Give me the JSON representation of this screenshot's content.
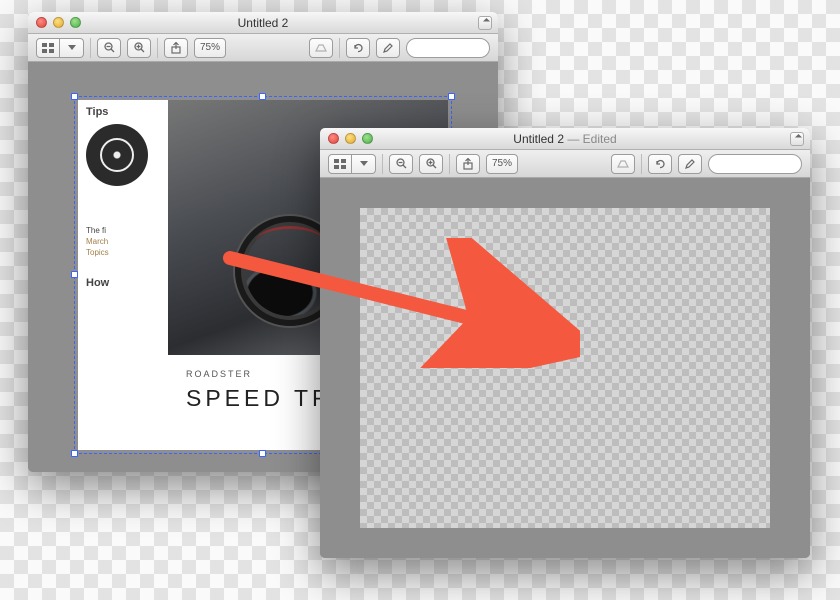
{
  "window1": {
    "title": "Untitled 2",
    "zoom": "75%",
    "search_placeholder": "",
    "page": {
      "left": {
        "heading": "Tips",
        "line1": "The fi",
        "meta1": "March",
        "meta2": "Topics",
        "heading2": "How"
      },
      "caption": {
        "kicker": "ROADSTER",
        "headline": "SPEED TRIP"
      }
    }
  },
  "window2": {
    "title": "Untitled 2",
    "edited_suffix": " — Edited",
    "zoom": "75%",
    "search_placeholder": ""
  },
  "icons": {
    "view_grid": "grid",
    "view_list": "list",
    "zoom_out": "−",
    "zoom_in": "+",
    "share": "share",
    "edit_pencil": "pencil",
    "rotate": "rotate",
    "markup": "markup",
    "search": "search"
  },
  "colors": {
    "window_bg": "#8e8e8e",
    "arrow": "#f4593f"
  }
}
